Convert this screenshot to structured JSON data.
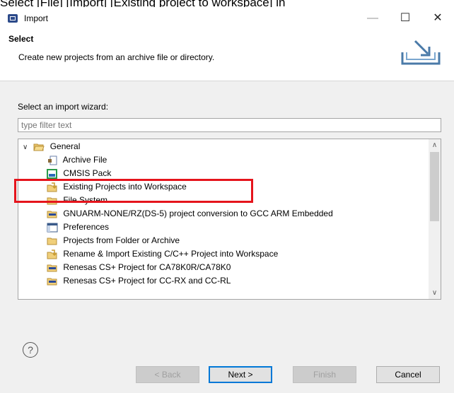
{
  "caption": "Select [File] [Import] [Existing project to workspace] in",
  "window": {
    "title": "Import",
    "minimize_glyph": "—",
    "maximize_glyph": "☐",
    "close_glyph": "✕"
  },
  "header": {
    "title": "Select",
    "description": "Create new projects from an archive file or directory."
  },
  "wizard": {
    "label": "Select an import wizard:",
    "filter_placeholder": "type filter text"
  },
  "tree": {
    "root": {
      "label": "General",
      "expander": "∨"
    },
    "items": [
      {
        "label": "Archive File",
        "icon": "archive-icon"
      },
      {
        "label": "CMSIS Pack",
        "icon": "cmsis-pack-icon"
      },
      {
        "label": "Existing Projects into Workspace",
        "icon": "existing-projects-icon"
      },
      {
        "label": "File System",
        "icon": "folder-icon"
      },
      {
        "label": "GNUARM-NONE/RZ(DS-5)  project conversion to GCC ARM Embedded",
        "icon": "project-folder-icon"
      },
      {
        "label": "Preferences",
        "icon": "preferences-icon"
      },
      {
        "label": "Projects from Folder or Archive",
        "icon": "folder-icon"
      },
      {
        "label": "Rename & Import Existing C/C++ Project into Workspace",
        "icon": "existing-projects-icon"
      },
      {
        "label": "Renesas CS+ Project for CA78K0R/CA78K0",
        "icon": "project-folder-icon"
      },
      {
        "label": "Renesas CS+ Project for CC-RX and CC-RL",
        "icon": "project-folder-icon"
      }
    ],
    "scroll_up": "∧",
    "scroll_down": "∨"
  },
  "footer": {
    "help": "?",
    "back": "< Back",
    "next": "Next >",
    "finish": "Finish",
    "cancel": "Cancel"
  },
  "colors": {
    "highlight_border": "#e5141c",
    "default_button_border": "#0078d7",
    "panel_background": "#f0f0f0"
  }
}
